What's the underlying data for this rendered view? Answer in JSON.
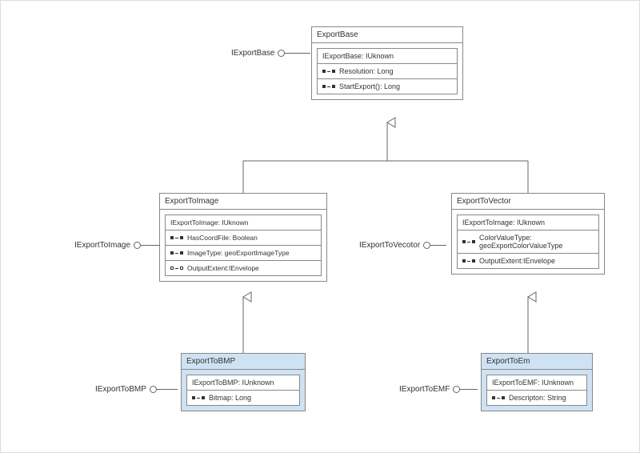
{
  "classes": {
    "exportBase": {
      "name": "ExportBase",
      "header": "IExportBase: IUknown",
      "members": [
        {
          "icon": "filled",
          "text": "Resolution: Long"
        },
        {
          "icon": "filled",
          "text": "StartExport(): Long"
        }
      ],
      "lollipop": "IExportBase"
    },
    "exportToImage": {
      "name": "ExportToImage",
      "header": "IExportToImage: IUknown",
      "members": [
        {
          "icon": "filled",
          "text": "HasCoordFile: Boolean"
        },
        {
          "icon": "filled",
          "text": "ImageType: geoExportImageType"
        },
        {
          "icon": "open",
          "text": "OutputExtent:IEnvelope"
        }
      ],
      "lollipop": "IExportToImage"
    },
    "exportToVector": {
      "name": "ExportToVector",
      "header": "IExportToImage: IUknown",
      "members": [
        {
          "icon": "filled",
          "text": "ColorValueType: geoExportColorValueType"
        },
        {
          "icon": "filled",
          "text": "OutputExtent:IEnvelope"
        }
      ],
      "lollipop": "IExportToVecotor"
    },
    "exportToBMP": {
      "name": "ExportToBMP",
      "header": "IExportToBMP: IUnknown",
      "members": [
        {
          "icon": "filled",
          "text": "Bitmap: Long"
        }
      ],
      "lollipop": "IExportToBMP"
    },
    "exportToEm": {
      "name": "ExportToEm",
      "header": "IExportToEMF: IUnknown",
      "members": [
        {
          "icon": "filled",
          "text": "Descripton: String"
        }
      ],
      "lollipop": "IExportToEMF"
    }
  }
}
